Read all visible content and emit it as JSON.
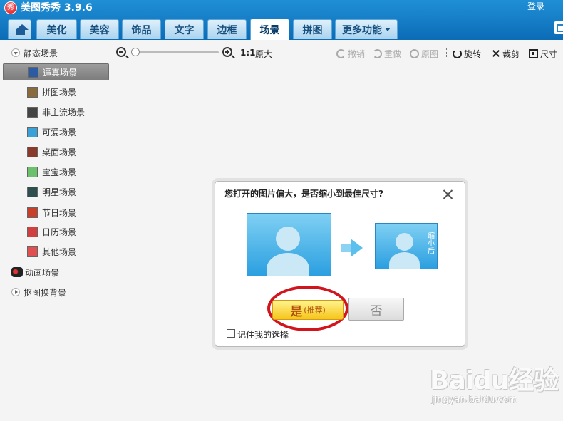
{
  "window": {
    "logo_glyph": "秀",
    "title": "美图秀秀 3.9.6",
    "login": "登录"
  },
  "tabs": [
    "美化",
    "美容",
    "饰品",
    "文字",
    "边框",
    "场景",
    "拼图",
    "更多功能"
  ],
  "active_tab": "场景",
  "sidebar": {
    "static_group": "静态场景",
    "static_items": [
      {
        "label": "逼真场景",
        "selected": true,
        "thumb_color": "#2b5ca3"
      },
      {
        "label": "拼图场景",
        "selected": false,
        "thumb_color": "#8a6a3c"
      },
      {
        "label": "非主流场景",
        "selected": false,
        "thumb_color": "#444444"
      },
      {
        "label": "可爱场景",
        "selected": false,
        "thumb_color": "#3aa0d8"
      },
      {
        "label": "桌面场景",
        "selected": false,
        "thumb_color": "#8a3a2a"
      },
      {
        "label": "宝宝场景",
        "selected": false,
        "thumb_color": "#6bc06b"
      },
      {
        "label": "明星场景",
        "selected": false,
        "thumb_color": "#2f4f4f"
      },
      {
        "label": "节日场景",
        "selected": false,
        "thumb_color": "#c8402a"
      },
      {
        "label": "日历场景",
        "selected": false,
        "thumb_color": "#d04040"
      },
      {
        "label": "其他场景",
        "selected": false,
        "thumb_color": "#e05050"
      }
    ],
    "animated_group": "动画场景",
    "cutout_group": "抠图换背景"
  },
  "toolbar": {
    "zoom_level": 0,
    "ratio": "1:1",
    "original_size": "原大",
    "undo": "撤销",
    "redo": "重做",
    "reset": "原图",
    "rotate": "旋转",
    "crop": "裁剪",
    "resize": "尺寸"
  },
  "dialog": {
    "title": "您打开的图片偏大，是否缩小到最佳尺寸?",
    "small_photo_caption": "缩小后",
    "yes_label": "是",
    "yes_recommend": "(推荐)",
    "no_label": "否",
    "remember_label": "记住我的选择",
    "remember_checked": false
  },
  "watermark": {
    "logo": "Baidu经验",
    "url": "jingyan.baidu.com"
  },
  "colors": {
    "header_blue": "#1f8fd6",
    "highlight_red": "#d2141c",
    "yes_yellow": "#f6c51a"
  }
}
